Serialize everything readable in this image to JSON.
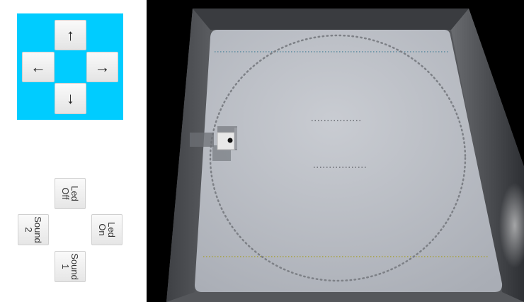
{
  "dpad": {
    "up_label": "↑",
    "left_label": "←",
    "right_label": "→",
    "down_label": "↓",
    "background_color": "#00ccff"
  },
  "actions": {
    "led_off_label": "Led\nOff",
    "sound2_label": "Sound\n2",
    "led_on_label": "Led\nOn",
    "sound1_label": "Sound\n1"
  },
  "scene": {
    "arena_surface_color": "#b8bcc4",
    "wall_color": "#4a4c50",
    "track_dot_color": "#7d8086",
    "line_top_color": "#5a8aa0",
    "line_bottom_color": "#a8a23c",
    "robot_color": "#e8e8e8"
  }
}
